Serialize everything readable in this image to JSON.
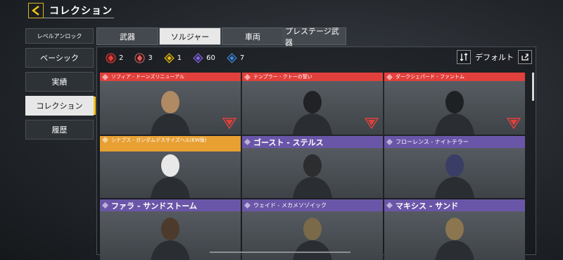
{
  "header": {
    "title": "コレクション"
  },
  "sidebar": {
    "items": [
      {
        "label": "レベルアンロック"
      },
      {
        "label": "ベーシック"
      },
      {
        "label": "実績"
      },
      {
        "label": "コレクション"
      },
      {
        "label": "履歴"
      }
    ]
  },
  "tabs": [
    {
      "label": "武器"
    },
    {
      "label": "ソルジャー"
    },
    {
      "label": "車両"
    },
    {
      "label": "プレステージ武器"
    }
  ],
  "counts": [
    {
      "value": "2",
      "color": "#e2403c"
    },
    {
      "value": "3",
      "color": "#e2403c"
    },
    {
      "value": "1",
      "color": "#f2c31b"
    },
    {
      "value": "60",
      "color": "#8a6fe0"
    },
    {
      "value": "7",
      "color": "#4a8fe0"
    }
  ],
  "sort": {
    "label": "デフォルト"
  },
  "cards": [
    {
      "name": "ソフィア - ドーンズリニューアル",
      "tier": "red"
    },
    {
      "name": "テンプラー - クトーの誓い",
      "tier": "red"
    },
    {
      "name": "ダークシェパード - ファントム",
      "tier": "red"
    },
    {
      "name": "シナプス - ガンダムデスサイズヘル(EW版)",
      "tier": "orange"
    },
    {
      "name": "ゴースト - ステルス",
      "tier": "purple"
    },
    {
      "name": "フローレンス - ナイトテラー",
      "tier": "purple"
    },
    {
      "name": "ファラ - サンドストーム",
      "tier": "purple"
    },
    {
      "name": "ウェイド - メカメソゾイック",
      "tier": "purple"
    },
    {
      "name": "マキシス - サンド",
      "tier": "purple"
    }
  ]
}
